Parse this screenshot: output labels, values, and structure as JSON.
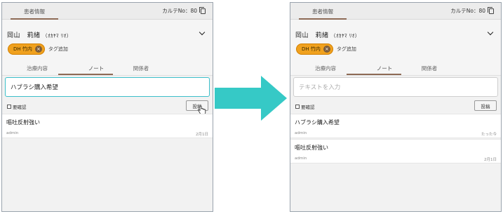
{
  "colors": {
    "accent_tag": "#f0a11e",
    "focus_border": "#3cbfca",
    "arrow": "#36c9c6",
    "tab_underline": "#8d6a55"
  },
  "panels": [
    {
      "header_tab": "患者情報",
      "karte_label": "カルテNo：80",
      "patient_name": "岡山　莉緒",
      "patient_kana": "（ｵｶﾔﾏ ﾘｵ）",
      "tag_label": "DH 竹内",
      "tag_add": "タグ追加",
      "tabs": [
        "治療内容",
        "ノート",
        "関係者"
      ],
      "active_tab": "ノート",
      "input_text": "ハブラシ購入希望",
      "checkbox_label": "要確認",
      "post_button": "投稿",
      "notes": [
        {
          "text": "嘔吐反射強い",
          "author": "admin",
          "date": "2月1日"
        }
      ]
    },
    {
      "header_tab": "患者情報",
      "karte_label": "カルテNo：80",
      "patient_name": "岡山　莉緒",
      "patient_kana": "（ｵｶﾔﾏ ﾘｵ）",
      "tag_label": "DH 竹内",
      "tag_add": "タグ追加",
      "tabs": [
        "治療内容",
        "ノート",
        "関係者"
      ],
      "active_tab": "ノート",
      "input_placeholder": "テキストを入力",
      "checkbox_label": "要確認",
      "post_button": "投稿",
      "notes": [
        {
          "text": "ハブラシ購入希望",
          "author": "admin",
          "date": "たった今"
        },
        {
          "text": "嘔吐反射強い",
          "author": "admin",
          "date": "2月1日"
        }
      ]
    }
  ]
}
